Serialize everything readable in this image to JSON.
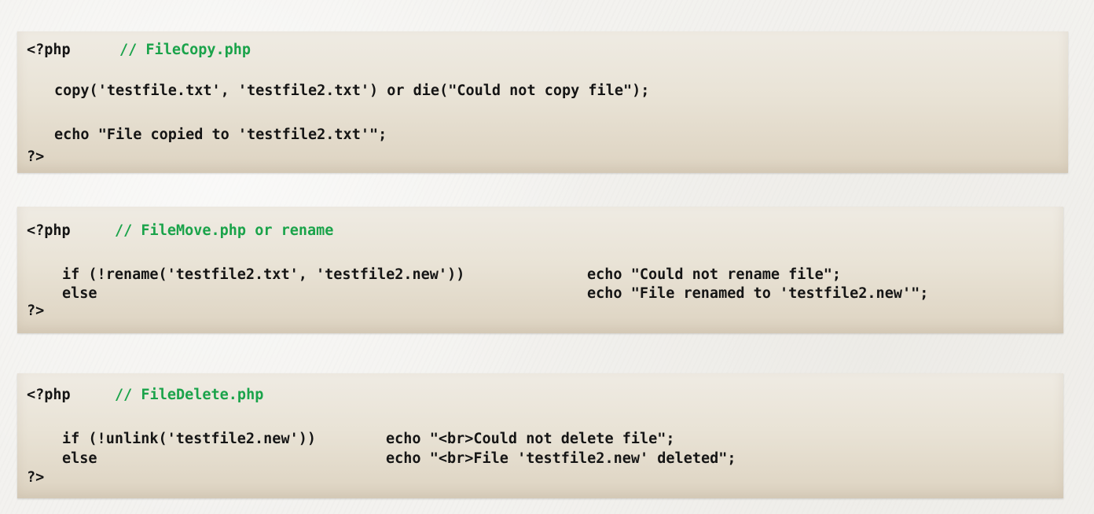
{
  "blocks": [
    {
      "open_tag": "<?php",
      "comment": "// FileCopy.php",
      "line1": "copy('testfile.txt', 'testfile2.txt') or die(\"Could not copy file\");",
      "line2": "echo \"File copied to 'testfile2.txt'\";",
      "close_tag": "?>"
    },
    {
      "open_tag": "<?php",
      "comment": "// FileMove.php or rename",
      "if_line": "if (!rename('testfile2.txt', 'testfile2.new'))",
      "if_action": "echo \"Could not rename file\";",
      "else_line": "else",
      "else_action": "echo \"File renamed to 'testfile2.new'\";",
      "close_tag": "?>"
    },
    {
      "open_tag": "<?php",
      "comment": "// FileDelete.php",
      "if_line": "if (!unlink('testfile2.new'))",
      "if_action": "echo \"<br>Could not delete file\";",
      "else_line": "else",
      "else_action": "echo \"<br>File 'testfile2.new' deleted\";",
      "close_tag": "?>"
    }
  ]
}
